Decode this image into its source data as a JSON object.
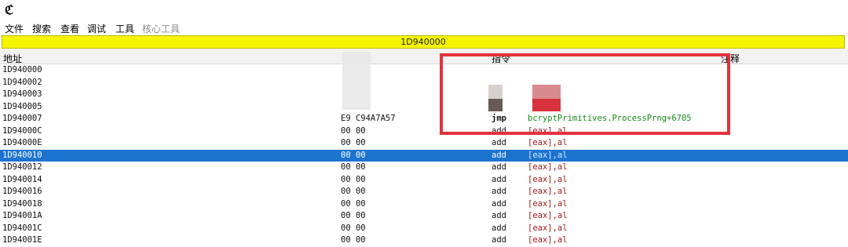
{
  "app": {
    "icon": "cheat-engine-c-icon"
  },
  "menu": [
    {
      "label": "文件",
      "enabled": true
    },
    {
      "label": "搜索",
      "enabled": true
    },
    {
      "label": "查看",
      "enabled": true
    },
    {
      "label": "调试",
      "enabled": true
    },
    {
      "label": "工具",
      "enabled": true
    },
    {
      "label": "核心工具",
      "enabled": false
    }
  ],
  "address_bar": {
    "value": "1D940000",
    "color": "#f5f500"
  },
  "columns": {
    "address": "地址",
    "bytes": "",
    "opcode": "指令",
    "comment": "注释"
  },
  "rows": [
    {
      "address": "1D940000",
      "bytes": "",
      "mnemonic": "",
      "operand": ""
    },
    {
      "address": "1D940002",
      "bytes": "",
      "mnemonic": "",
      "operand": ""
    },
    {
      "address": "1D940003",
      "bytes": "",
      "mnemonic": "",
      "operand": ""
    },
    {
      "address": "1D940005",
      "bytes": "",
      "mnemonic": "",
      "operand": ""
    },
    {
      "address": "1D940007",
      "bytes": "E9 C94A7A57",
      "mnemonic": "jmp",
      "operand": "bcryptPrimitives.ProcessPrng+6705"
    },
    {
      "address": "1D94000C",
      "bytes": "00 00",
      "mnemonic": "add",
      "operand": "[eax],al"
    },
    {
      "address": "1D94000E",
      "bytes": "00 00",
      "mnemonic": "add",
      "operand": "[eax],al"
    },
    {
      "address": "1D940010",
      "bytes": "00 00",
      "mnemonic": "add",
      "operand": "[eax],al"
    },
    {
      "address": "1D940012",
      "bytes": "00 00",
      "mnemonic": "add",
      "operand": "[eax],al"
    },
    {
      "address": "1D940014",
      "bytes": "00 00",
      "mnemonic": "add",
      "operand": "[eax],al"
    },
    {
      "address": "1D940016",
      "bytes": "00 00",
      "mnemonic": "add",
      "operand": "[eax],al"
    },
    {
      "address": "1D940018",
      "bytes": "00 00",
      "mnemonic": "add",
      "operand": "[eax],al"
    },
    {
      "address": "1D94001A",
      "bytes": "00 00",
      "mnemonic": "add",
      "operand": "[eax],al"
    },
    {
      "address": "1D94001C",
      "bytes": "00 00",
      "mnemonic": "add",
      "operand": "[eax],al"
    },
    {
      "address": "1D94001E",
      "bytes": "00 00",
      "mnemonic": "add",
      "operand": "[eax],al"
    }
  ],
  "selected_row": 7,
  "colors": {
    "selection": "#1c74cf",
    "annotation_box": "#e2323b",
    "operand": "#a01818",
    "jump_target": "#148a14"
  }
}
